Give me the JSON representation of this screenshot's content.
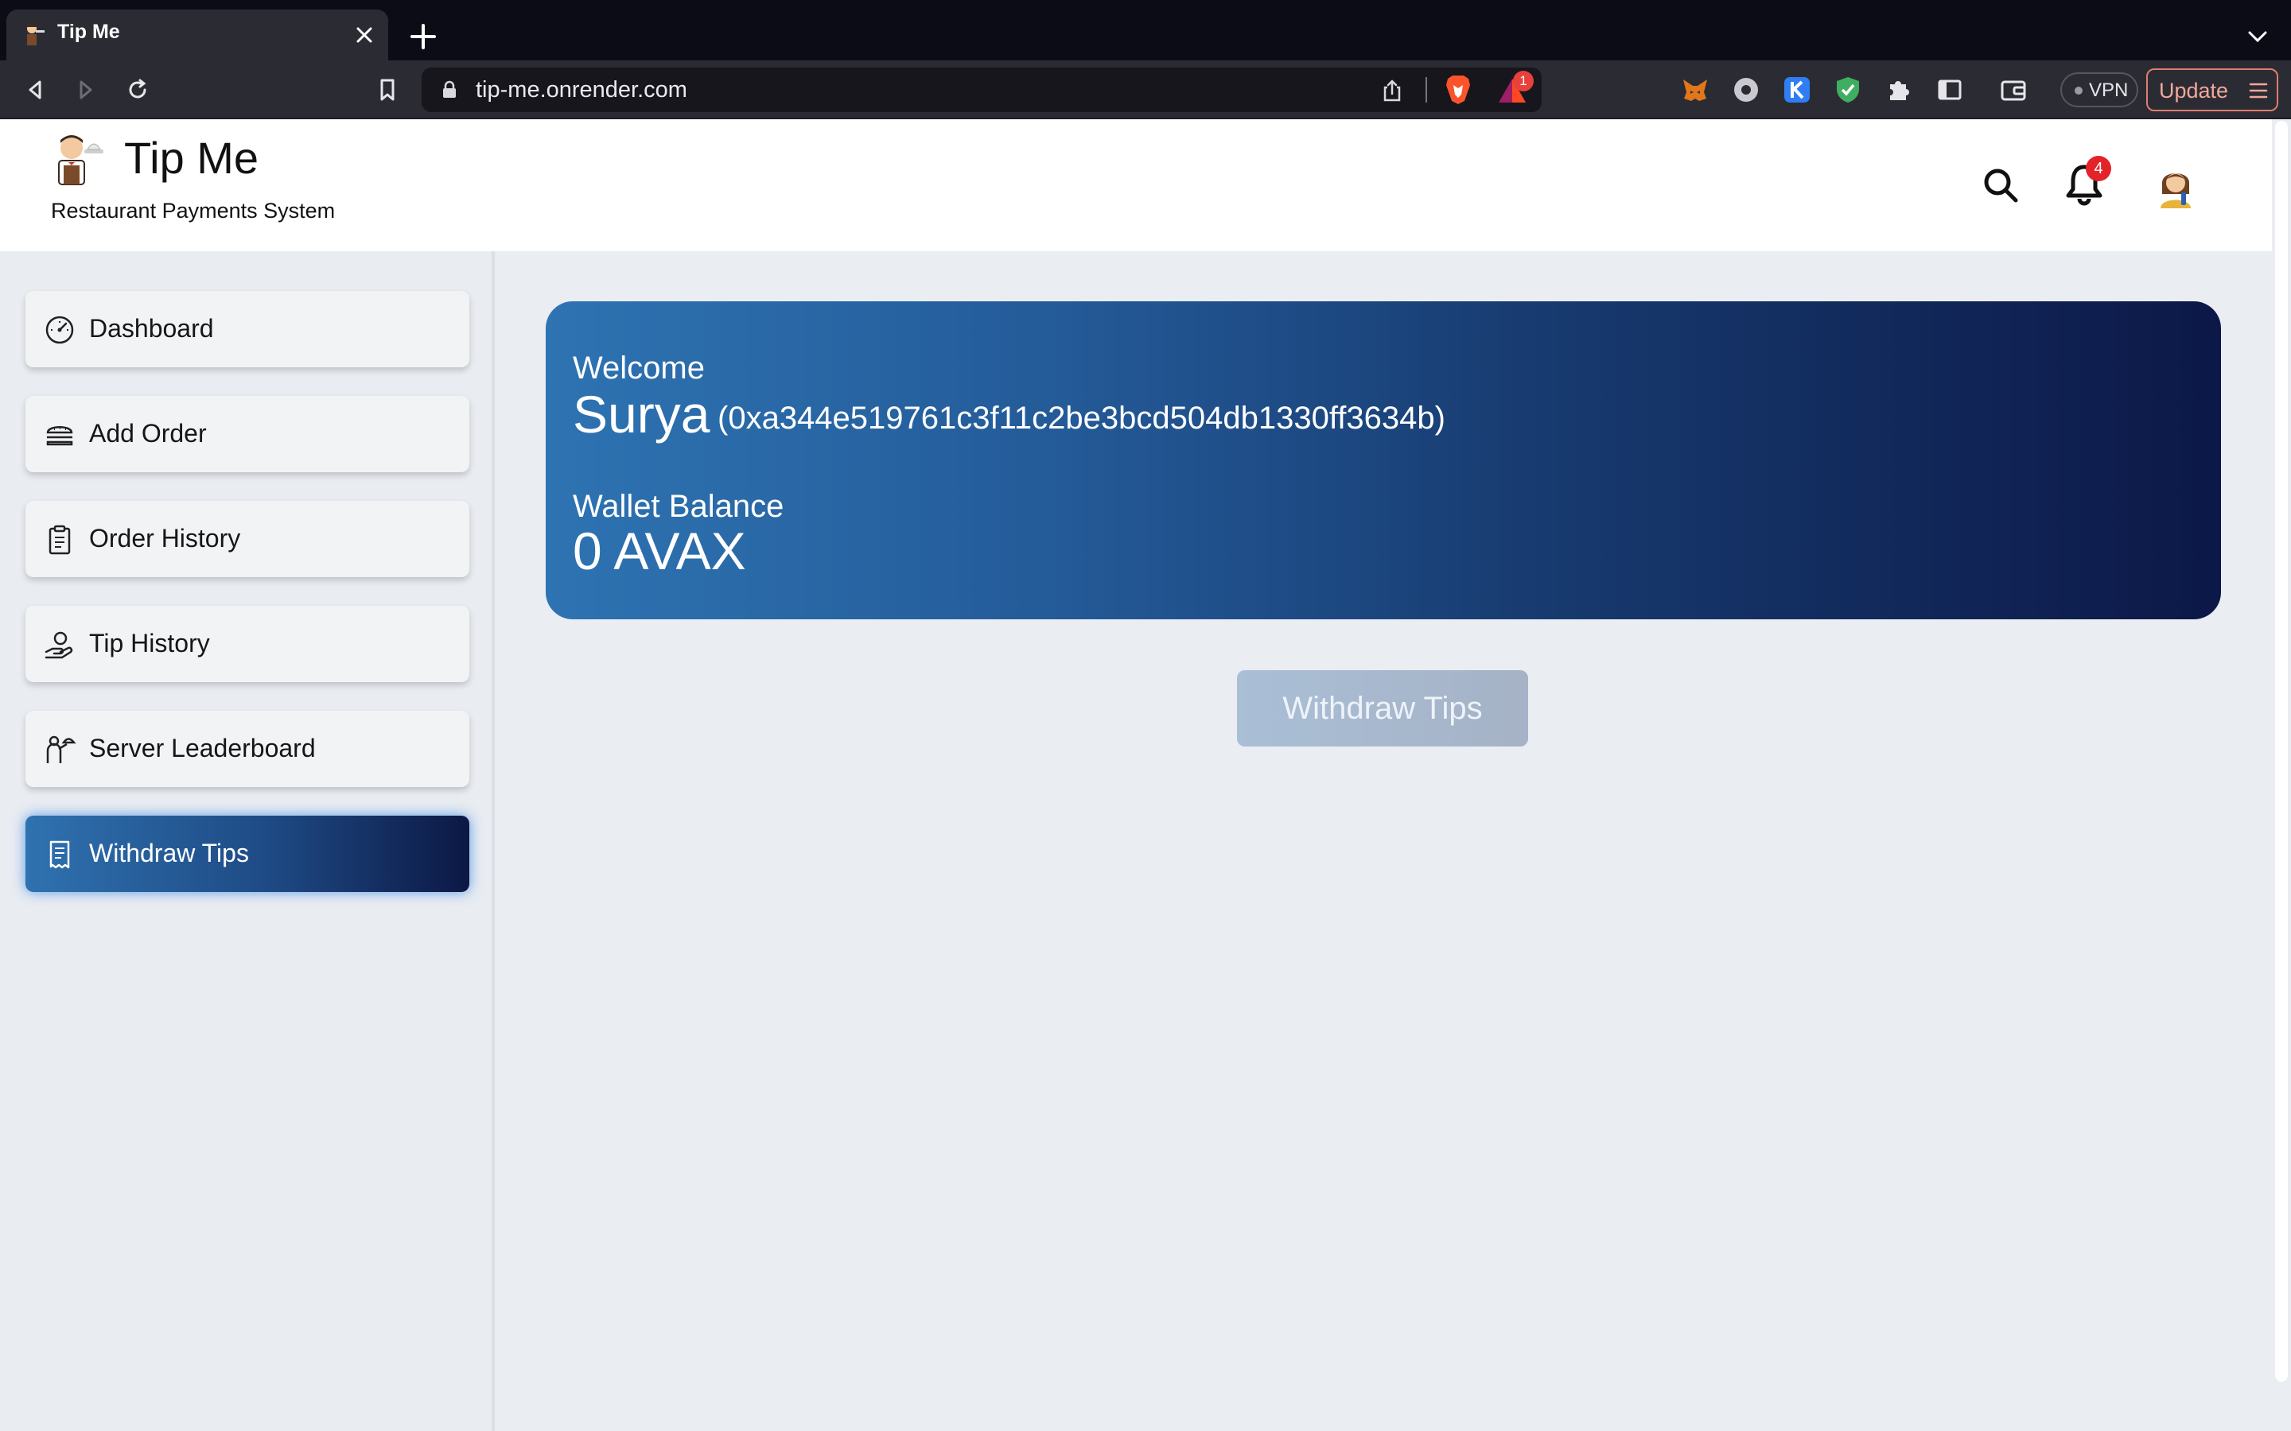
{
  "browser": {
    "tab_title": "Tip Me",
    "url": "tip-me.onrender.com",
    "rewards_badge": "1",
    "vpn_label": "VPN",
    "update_label": "Update"
  },
  "header": {
    "title": "Tip Me",
    "subtitle": "Restaurant Payments System",
    "notification_count": "4"
  },
  "sidebar": {
    "items": [
      {
        "label": "Dashboard",
        "icon": "gauge-icon"
      },
      {
        "label": "Add Order",
        "icon": "burger-icon"
      },
      {
        "label": "Order History",
        "icon": "clipboard-icon"
      },
      {
        "label": "Tip History",
        "icon": "hand-coin-icon"
      },
      {
        "label": "Server Leaderboard",
        "icon": "waiter-icon"
      },
      {
        "label": "Withdraw Tips",
        "icon": "receipt-icon",
        "active": true
      }
    ]
  },
  "welcome": {
    "label": "Welcome",
    "name": "Surya",
    "address": "(0xa344e519761c3f11c2be3bcd504db1330ff3634b)",
    "balance_label": "Wallet Balance",
    "balance_value": "0 AVAX"
  },
  "actions": {
    "withdraw_label": "Withdraw Tips"
  },
  "colors": {
    "accent_start": "#2f72b0",
    "accent_end": "#0c1845",
    "page_background": "#eaedf2",
    "badge_red": "#e3232a"
  }
}
